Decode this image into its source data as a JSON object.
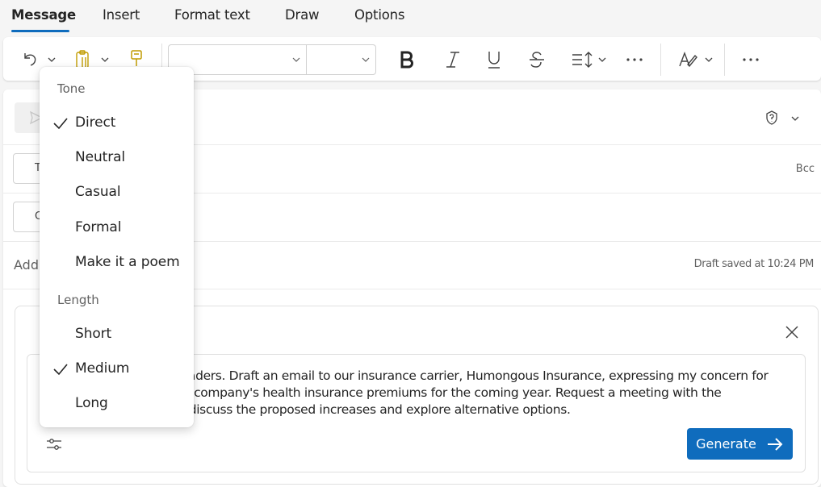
{
  "tabs": [
    {
      "label": "Message",
      "active": true
    },
    {
      "label": "Insert",
      "active": false
    },
    {
      "label": "Format text",
      "active": false
    },
    {
      "label": "Draw",
      "active": false
    },
    {
      "label": "Options",
      "active": false
    }
  ],
  "toolbar": {
    "icons": [
      "undo-icon",
      "paste-icon",
      "format-painter-icon",
      "bold-icon",
      "italic-icon",
      "underline-icon",
      "strikethrough-icon",
      "paragraph-spacing-icon",
      "more-formatting-icon",
      "editor-icon",
      "more-options-icon"
    ]
  },
  "compose": {
    "to_label": "To",
    "cc_label": "Cc",
    "bcc_label": "Bcc",
    "subject_placeholder": "Add a subject",
    "draft_status": "Draft saved at 10:24 PM"
  },
  "copilot": {
    "prompt_lines": [
      "d Traders. Draft an email to our insurance carrier, Humongous Insurance, expressing my concern for",
      "ur company's health insurance premiums for the coming year. Request a meeting with the",
      "o discuss the proposed increases and explore alternative options."
    ],
    "generate_label": "Generate"
  },
  "menu": {
    "tone_header": "Tone",
    "tone_items": [
      {
        "label": "Direct",
        "checked": true
      },
      {
        "label": "Neutral",
        "checked": false
      },
      {
        "label": "Casual",
        "checked": false
      },
      {
        "label": "Formal",
        "checked": false
      },
      {
        "label": "Make it a poem",
        "checked": false
      }
    ],
    "length_header": "Length",
    "length_items": [
      {
        "label": "Short",
        "checked": false
      },
      {
        "label": "Medium",
        "checked": true
      },
      {
        "label": "Long",
        "checked": false
      }
    ]
  },
  "colors": {
    "accent": "#0f6cbd",
    "text": "#242424",
    "secondary_text": "#616161",
    "format_painter": "#c19c00"
  }
}
